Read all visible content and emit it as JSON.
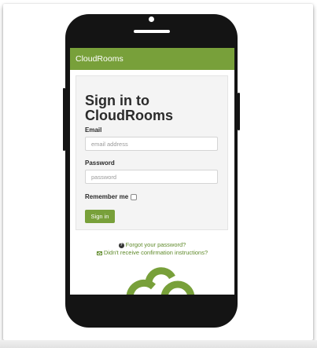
{
  "app": {
    "brand": "CloudRooms"
  },
  "signin": {
    "title": "Sign in to CloudRooms",
    "email_label": "Email",
    "email_placeholder": "email address",
    "password_label": "Password",
    "password_placeholder": "password",
    "remember_label": "Remember me",
    "remember_checked": false,
    "submit_label": "Sign in"
  },
  "links": {
    "forgot_password": "Forgot your password?",
    "confirmation": "Didn't receive confirmation instructions?"
  },
  "icons": {
    "forgot": "question-circle-icon",
    "confirmation": "envelope-icon",
    "logo": "cloudrooms-logo"
  },
  "colors": {
    "accent": "#78a03a",
    "link": "#5f8a2a",
    "phone": "#141414",
    "card": "#f4f4f4"
  }
}
